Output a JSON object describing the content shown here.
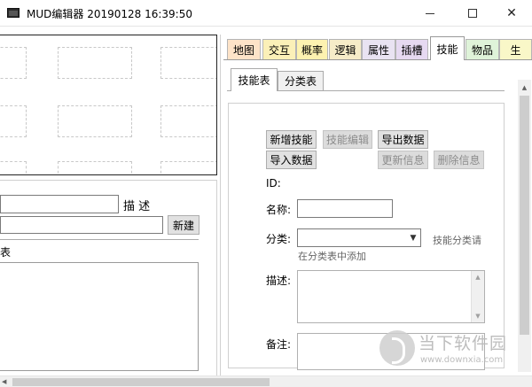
{
  "window": {
    "title": "MUD编辑器 20190128 16:39:50",
    "minimize": "—",
    "maximize": "□",
    "close": "✕"
  },
  "left": {
    "desc_label": "描 述",
    "new_button": "新建",
    "cut_label": "表"
  },
  "tabs": [
    {
      "label": "地图",
      "color": "#fde3c8"
    },
    {
      "label": "交互",
      "color": "#fbf0b8"
    },
    {
      "label": "概率",
      "color": "#fdf2b0"
    },
    {
      "label": "逻辑",
      "color": "#f6ecc8"
    },
    {
      "label": "属性",
      "color": "#e9e3f2"
    },
    {
      "label": "插槽",
      "color": "#e6d9f1"
    },
    {
      "label": "技能",
      "color": "#ffffff"
    },
    {
      "label": "物品",
      "color": "#dff3d9"
    },
    {
      "label": "生",
      "color": "#f9f7c8"
    }
  ],
  "subtabs": [
    {
      "label": "技能表"
    },
    {
      "label": "分类表"
    }
  ],
  "skill_form": {
    "buttons": {
      "add": "新增技能",
      "edit": "技能编辑",
      "export": "导出数据",
      "import": "导入数据",
      "update": "更新信息",
      "delete": "删除信息"
    },
    "id_label": "ID:",
    "name_label": "名称:",
    "category_label": "分类:",
    "category_hint_right": "技能分类请",
    "category_hint_below": "在分类表中添加",
    "desc_label": "描述:",
    "note_label": "备注:"
  },
  "watermark": {
    "name": "当下软件园",
    "url": "www.downxia.com"
  }
}
